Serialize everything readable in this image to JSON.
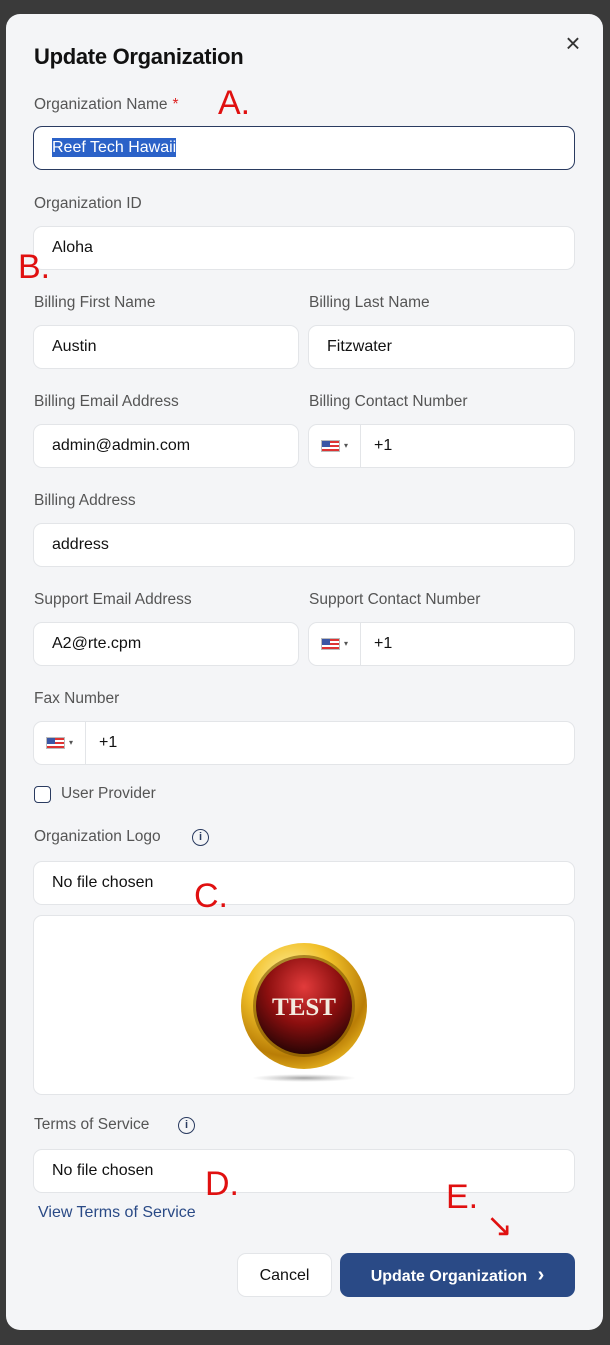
{
  "modal": {
    "title": "Update Organization",
    "close_symbol": "×"
  },
  "fields": {
    "org_name": {
      "label": "Organization Name",
      "required_mark": "*",
      "value": "Reef Tech Hawaii"
    },
    "org_id": {
      "label": "Organization ID",
      "value": "Aloha"
    },
    "billing_first": {
      "label": "Billing First Name",
      "value": "Austin"
    },
    "billing_last": {
      "label": "Billing Last Name",
      "value": "Fitzwater"
    },
    "billing_email": {
      "label": "Billing Email Address",
      "value": "admin@admin.com"
    },
    "billing_phone": {
      "label": "Billing Contact Number",
      "value": "+1"
    },
    "billing_address": {
      "label": "Billing Address",
      "value": "address"
    },
    "support_email": {
      "label": "Support Email Address",
      "value": "A2@rte.cpm"
    },
    "support_phone": {
      "label": "Support Contact Number",
      "value": "+1"
    },
    "fax": {
      "label": "Fax Number",
      "value": "+1"
    },
    "user_provider": {
      "label": "User Provider",
      "checked": false
    },
    "logo": {
      "label": "Organization Logo",
      "file_text": "No file chosen",
      "badge_text": "TEST"
    },
    "tos": {
      "label": "Terms of Service",
      "file_text": "No file chosen",
      "link": "View Terms of Service"
    }
  },
  "annotations": {
    "a": "A.",
    "b": "B.",
    "c": "C.",
    "d": "D.",
    "e": "E.",
    "arrow": "↘"
  },
  "buttons": {
    "cancel": "Cancel",
    "submit": "Update Organization",
    "submit_chevron": "›"
  },
  "icons": {
    "info": "i",
    "flag": "us-flag-icon",
    "caret": "▾"
  },
  "colors": {
    "primary": "#2a4a86",
    "annotation": "#e01010",
    "required": "#d22222",
    "selection": "#2b62c8"
  }
}
